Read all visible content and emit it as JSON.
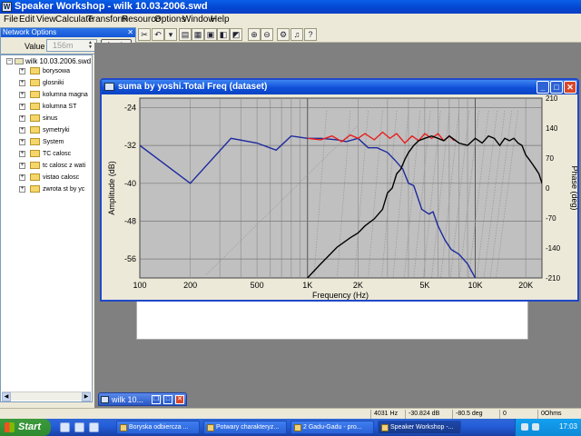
{
  "app": {
    "title": "Speaker Workshop - wilk 10.03.2006.swd",
    "icon": "speaker-workshop-app-icon"
  },
  "menubar": [
    "File",
    "Edit",
    "View",
    "Calculate",
    "Transform",
    "Resource",
    "Options",
    "Window",
    "Help"
  ],
  "network_options": {
    "title": "Network Options",
    "value_label": "Value",
    "value_placeholder": "156m",
    "apply_label": "Apply"
  },
  "tree": {
    "root": "wilk 10.03.2006.swd",
    "items": [
      "borysowa",
      "glosniki",
      "kolumna magna",
      "kolumna ST",
      "sinus",
      "symetryki",
      "System",
      "TC calosc",
      "tc calosc z wati",
      "vistao calosc",
      "zwrota st by yc"
    ]
  },
  "graph_window": {
    "title": "suma by yoshi.Total Freq (dataset)"
  },
  "minimized_window": {
    "title": "wilk 10..."
  },
  "chart_data": {
    "type": "line",
    "xlabel": "Frequency (Hz)",
    "ylabel": "Amplitude (dB)",
    "y2label": "Phase (deg)",
    "x_scale": "log",
    "xlim": [
      100,
      25000
    ],
    "ylim": [
      -60,
      -22
    ],
    "y2lim": [
      -210,
      210
    ],
    "x_ticks": [
      {
        "v": 100,
        "label": "100"
      },
      {
        "v": 200,
        "label": "200"
      },
      {
        "v": 500,
        "label": "500"
      },
      {
        "v": 1000,
        "label": "1K"
      },
      {
        "v": 2000,
        "label": "2K"
      },
      {
        "v": 5000,
        "label": "5K"
      },
      {
        "v": 10000,
        "label": "10K"
      },
      {
        "v": 20000,
        "label": "20K"
      }
    ],
    "y_ticks": [
      {
        "v": -24,
        "label": "-24"
      },
      {
        "v": -32,
        "label": "-32"
      },
      {
        "v": -40,
        "label": "-40"
      },
      {
        "v": -48,
        "label": "-48"
      },
      {
        "v": -56,
        "label": "-56"
      }
    ],
    "y2_ticks": [
      {
        "v": 210,
        "label": "210"
      },
      {
        "v": 140,
        "label": "140"
      },
      {
        "v": 70,
        "label": "70"
      },
      {
        "v": 0,
        "label": "0"
      },
      {
        "v": -70,
        "label": "-70"
      },
      {
        "v": -140,
        "label": "-140"
      },
      {
        "v": -210,
        "label": "-210"
      }
    ],
    "grid": true,
    "background": "#c0c0c0",
    "series": [
      {
        "color": "#1c2a9e",
        "x": [
          100,
          200,
          350,
          500,
          650,
          800,
          1000,
          1200,
          1500,
          1700,
          2000,
          2300,
          2600,
          3000,
          3300,
          3700,
          4000,
          4300,
          4800,
          5300,
          5600,
          6000,
          6600,
          7200,
          8000,
          9000,
          10000
        ],
        "y": [
          -32.0,
          -40.0,
          -30.5,
          -31.5,
          -33.0,
          -30.0,
          -30.5,
          -30.5,
          -30.8,
          -31.2,
          -30.5,
          -32.5,
          -32.5,
          -33.5,
          -35.0,
          -37.0,
          -40.0,
          -40.5,
          -45.5,
          -46.5,
          -46.0,
          -49.0,
          -52.0,
          -54.0,
          -55.0,
          -57.0,
          -60.0
        ]
      },
      {
        "color": "#e81e1e",
        "x": [
          1000,
          1200,
          1400,
          1600,
          1800,
          2000,
          2200,
          2500,
          2800,
          3100,
          3400,
          3800,
          4200,
          4600,
          5000,
          5500,
          6000,
          6500,
          7000,
          7500
        ],
        "y": [
          -30.5,
          -30.8,
          -30.0,
          -31.2,
          -29.8,
          -30.5,
          -29.5,
          -30.8,
          -29.2,
          -30.5,
          -29.5,
          -31.5,
          -30.0,
          -31.0,
          -29.5,
          -30.5,
          -29.5,
          -31.0,
          -30.0,
          -31.0
        ]
      },
      {
        "color": "#000000",
        "x": [
          1000,
          1200,
          1500,
          1800,
          2000,
          2200,
          2500,
          2800,
          3000,
          3200,
          3400,
          3600,
          3800,
          4000,
          4300,
          4600,
          5000,
          5500,
          6000,
          6500,
          7000,
          8000,
          9000,
          10000,
          11000,
          12000,
          13000,
          14000,
          15000,
          16000,
          17000,
          18000,
          19000,
          20000,
          21000,
          22000,
          23000,
          24000,
          25000
        ],
        "y": [
          -60.0,
          -57.0,
          -53.5,
          -51.5,
          -50.5,
          -49.0,
          -47.5,
          -45.5,
          -42.0,
          -41.0,
          -38.0,
          -37.0,
          -35.0,
          -33.5,
          -32.0,
          -31.0,
          -30.5,
          -30.0,
          -30.5,
          -31.0,
          -30.0,
          -31.5,
          -32.0,
          -30.5,
          -31.5,
          -30.0,
          -30.5,
          -32.0,
          -30.5,
          -31.0,
          -30.5,
          -31.5,
          -32.0,
          -34.0,
          -35.0,
          -36.0,
          -37.0,
          -38.0,
          -40.0
        ]
      }
    ],
    "guides": {
      "color": "#9a9a9a",
      "x_positions": [
        1300,
        1800,
        2300,
        2800,
        3400,
        4000,
        4700,
        5400,
        6200,
        7000,
        8000,
        9200,
        10500,
        12000,
        13500,
        15000,
        16500,
        18000
      ]
    }
  },
  "statusbar": [
    "4031 Hz",
    "-30.824 dB",
    "-80.5 deg",
    "0",
    "0Ohms"
  ],
  "taskbar": {
    "start_label": "Start",
    "tasks": [
      "Boryska odbiercza ...",
      "Potwary charakteryz...",
      "2 Gadu-Gadu - pro...",
      "Speaker Workshop -..."
    ],
    "clock": "17:03"
  }
}
